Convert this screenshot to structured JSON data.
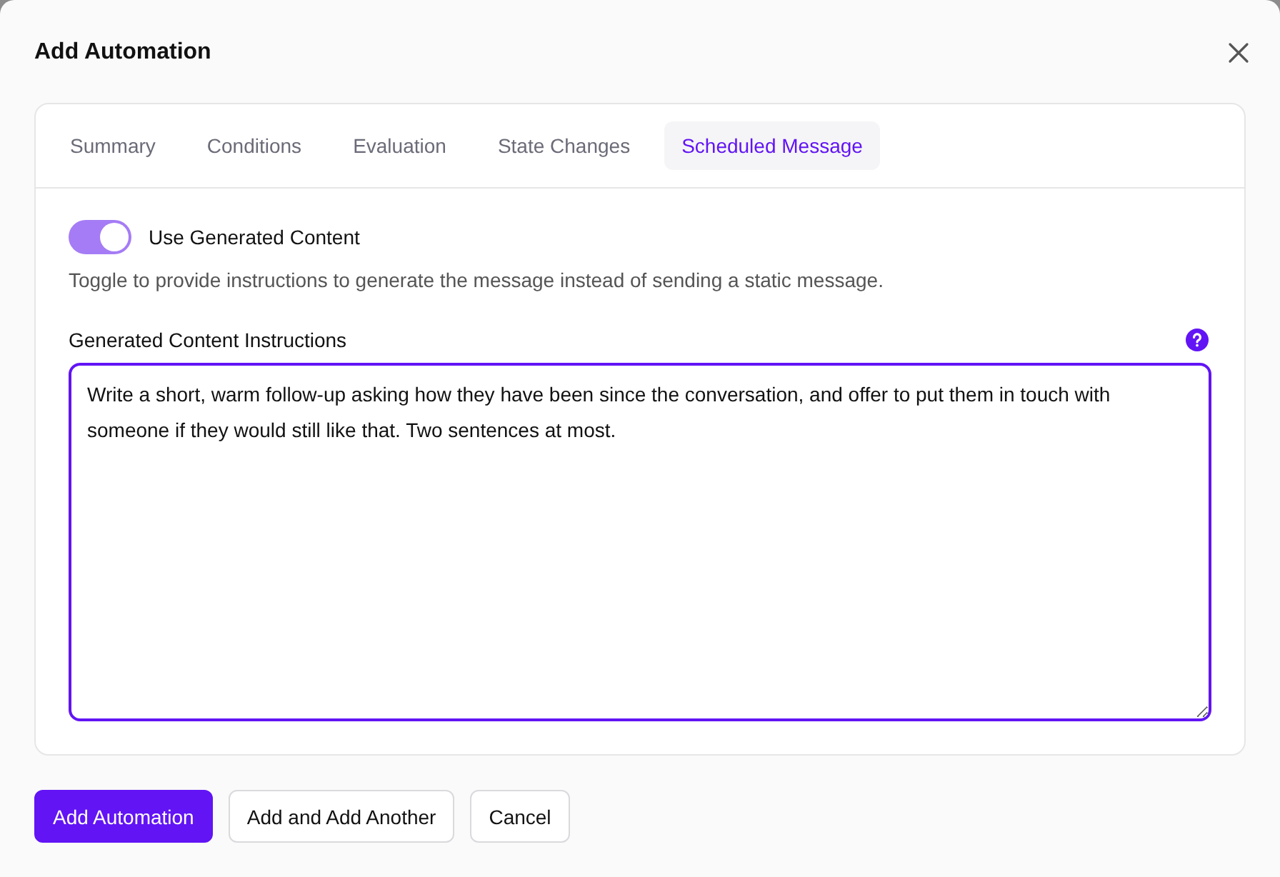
{
  "dialog": {
    "title": "Add Automation"
  },
  "tabs": [
    {
      "label": "Summary",
      "selected": false
    },
    {
      "label": "Conditions",
      "selected": false
    },
    {
      "label": "Evaluation",
      "selected": false
    },
    {
      "label": "State Changes",
      "selected": false
    },
    {
      "label": "Scheduled Message",
      "selected": true
    }
  ],
  "toggle": {
    "label": "Use Generated Content",
    "on": true,
    "description": "Toggle to provide instructions to generate the message instead of sending a static message."
  },
  "instructions": {
    "label": "Generated Content Instructions",
    "value": "Write a short, warm follow-up asking how they have been since the conversation, and offer to put them in touch with someone if they would still like that. Two sentences at most."
  },
  "buttons": [
    {
      "label": "Add Automation",
      "kind": "primary"
    },
    {
      "label": "Add and Add Another",
      "kind": "secondary"
    },
    {
      "label": "Cancel",
      "kind": "secondary"
    }
  ]
}
